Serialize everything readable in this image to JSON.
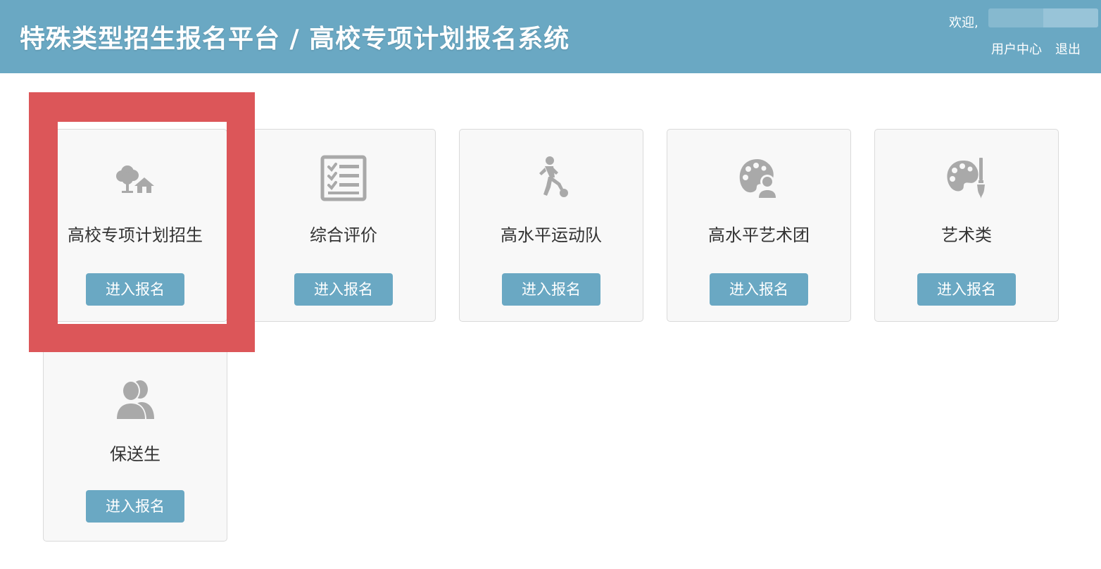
{
  "header": {
    "title": "特殊类型招生报名平台 / 高校专项计划报名系统",
    "welcome": "欢迎,",
    "user_center": "用户中心",
    "logout": "退出"
  },
  "cards": [
    {
      "label": "高校专项计划招生",
      "button": "进入报名",
      "icon": "tree-house-icon"
    },
    {
      "label": "综合评价",
      "button": "进入报名",
      "icon": "checklist-icon"
    },
    {
      "label": "高水平运动队",
      "button": "进入报名",
      "icon": "soccer-player-icon"
    },
    {
      "label": "高水平艺术团",
      "button": "进入报名",
      "icon": "palette-person-icon"
    },
    {
      "label": "艺术类",
      "button": "进入报名",
      "icon": "palette-brush-icon"
    },
    {
      "label": "保送生",
      "button": "进入报名",
      "icon": "users-icon"
    }
  ],
  "colors": {
    "header_bg": "#6aa8c3",
    "button_bg": "#6aa8c3",
    "card_bg": "#f8f8f8",
    "icon": "#a9a9a9",
    "highlight": "#dc5659"
  }
}
